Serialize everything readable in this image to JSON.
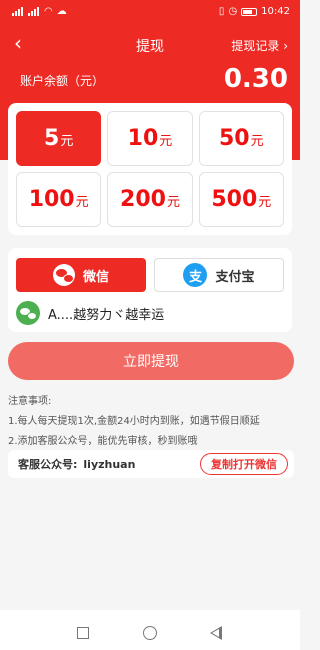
{
  "statusbar": {
    "time": "10:42",
    "battery_level": 0.62,
    "status_icons": [
      "signal-icon",
      "signal-icon",
      "wifi-icon",
      "cloud-icon",
      "vibrate-icon",
      "alarm-icon"
    ]
  },
  "header": {
    "title": "提现",
    "right_link": "提现记录",
    "balance_label": "账户余额（元）",
    "balance_value": "0.30",
    "color": "#ee2a24"
  },
  "amounts": [
    {
      "value": "5",
      "unit": "元",
      "selected": true
    },
    {
      "value": "10",
      "unit": "元"
    },
    {
      "value": "50",
      "unit": "元"
    },
    {
      "value": "100",
      "unit": "元"
    },
    {
      "value": "200",
      "unit": "元"
    },
    {
      "value": "500",
      "unit": "元"
    }
  ],
  "payment": {
    "tabs": [
      {
        "label": "微信",
        "selected": true
      },
      {
        "label": "支付宝"
      }
    ],
    "alipay_glyph": "支",
    "account_name": "A....越努力ヾ越幸运"
  },
  "submit_label": "立即提现",
  "notes": {
    "title": "注意事项:",
    "items": [
      "1.每人每天提现1次,金额24小时内到账，如遇节假日顺延",
      "2.添加客服公众号，能优先审核，秒到账哦"
    ]
  },
  "service": {
    "label": "客服公众号:",
    "handle": "liyzhuan",
    "button": "复制打开微信"
  }
}
